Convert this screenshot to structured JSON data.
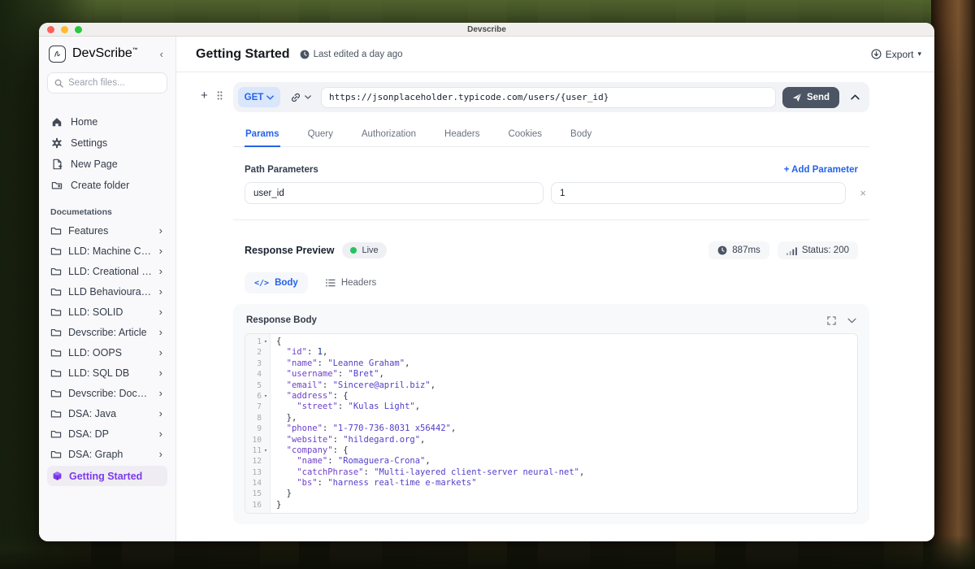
{
  "titlebar": {
    "title": "Devscribe"
  },
  "sidebar": {
    "brand": "DevScribe",
    "brand_tm": "™",
    "collapse_glyph": "‹",
    "search_placeholder": "Search files...",
    "nav": [
      {
        "label": "Home",
        "icon": "home-icon"
      },
      {
        "label": "Settings",
        "icon": "gear-icon"
      },
      {
        "label": "New Page",
        "icon": "new-page-icon"
      },
      {
        "label": "Create folder",
        "icon": "create-folder-icon"
      }
    ],
    "section_label": "Documetations",
    "chevron_glyph": "›",
    "docs": [
      "Features",
      "LLD: Machine Codir",
      "LLD: Creational DP",
      "LLD Behavioural DP",
      "LLD: SOLID",
      "Devscribe: Article",
      "LLD: OOPS",
      "LLD: SQL DB",
      "Devscribe: Docume",
      "DSA: Java",
      "DSA: DP",
      "DSA: Graph"
    ],
    "active": {
      "label": "Getting Started"
    }
  },
  "header": {
    "title": "Getting Started",
    "last_edited": "Last edited a day ago",
    "export_label": "Export",
    "export_caret": "▾"
  },
  "request": {
    "method": "GET",
    "url": "https://jsonplaceholder.typicode.com/users/{user_id}",
    "send_label": "Send",
    "tabs": [
      "Params",
      "Query",
      "Authorization",
      "Headers",
      "Cookies",
      "Body"
    ],
    "active_tab": "Params",
    "path_params": {
      "title": "Path Parameters",
      "add_label": "+ Add Parameter",
      "remove_glyph": "×",
      "rows": [
        {
          "key": "user_id",
          "value": "1"
        }
      ]
    }
  },
  "response": {
    "preview_label": "Response Preview",
    "live_label": "Live",
    "latency": "887ms",
    "status": "Status: 200",
    "tabs": [
      {
        "label": "Body"
      },
      {
        "label": "Headers"
      }
    ],
    "body_panel_title": "Response Body",
    "fold_glyph": "▾",
    "code": {
      "lines": [
        {
          "n": 1,
          "fold": true,
          "indent": 0,
          "tokens": [
            [
              "p",
              "{"
            ]
          ]
        },
        {
          "n": 2,
          "fold": false,
          "indent": 1,
          "tokens": [
            [
              "k",
              "\"id\""
            ],
            [
              "p",
              ": "
            ],
            [
              "n",
              "1"
            ],
            [
              "p",
              ","
            ]
          ]
        },
        {
          "n": 3,
          "fold": false,
          "indent": 1,
          "tokens": [
            [
              "k",
              "\"name\""
            ],
            [
              "p",
              ": "
            ],
            [
              "s",
              "\"Leanne Graham\""
            ],
            [
              "p",
              ","
            ]
          ]
        },
        {
          "n": 4,
          "fold": false,
          "indent": 1,
          "tokens": [
            [
              "k",
              "\"username\""
            ],
            [
              "p",
              ": "
            ],
            [
              "s",
              "\"Bret\""
            ],
            [
              "p",
              ","
            ]
          ]
        },
        {
          "n": 5,
          "fold": false,
          "indent": 1,
          "tokens": [
            [
              "k",
              "\"email\""
            ],
            [
              "p",
              ": "
            ],
            [
              "s",
              "\"Sincere@april.biz\""
            ],
            [
              "p",
              ","
            ]
          ]
        },
        {
          "n": 6,
          "fold": true,
          "indent": 1,
          "tokens": [
            [
              "k",
              "\"address\""
            ],
            [
              "p",
              ": {"
            ]
          ]
        },
        {
          "n": 7,
          "fold": false,
          "indent": 2,
          "tokens": [
            [
              "k",
              "\"street\""
            ],
            [
              "p",
              ": "
            ],
            [
              "s",
              "\"Kulas Light\""
            ],
            [
              "p",
              ","
            ]
          ]
        },
        {
          "n": 8,
          "fold": false,
          "indent": 1,
          "tokens": [
            [
              "p",
              "},"
            ]
          ]
        },
        {
          "n": 9,
          "fold": false,
          "indent": 1,
          "tokens": [
            [
              "k",
              "\"phone\""
            ],
            [
              "p",
              ": "
            ],
            [
              "s",
              "\"1-770-736-8031 x56442\""
            ],
            [
              "p",
              ","
            ]
          ]
        },
        {
          "n": 10,
          "fold": false,
          "indent": 1,
          "tokens": [
            [
              "k",
              "\"website\""
            ],
            [
              "p",
              ": "
            ],
            [
              "s",
              "\"hildegard.org\""
            ],
            [
              "p",
              ","
            ]
          ]
        },
        {
          "n": 11,
          "fold": true,
          "indent": 1,
          "tokens": [
            [
              "k",
              "\"company\""
            ],
            [
              "p",
              ": {"
            ]
          ]
        },
        {
          "n": 12,
          "fold": false,
          "indent": 2,
          "tokens": [
            [
              "k",
              "\"name\""
            ],
            [
              "p",
              ": "
            ],
            [
              "s",
              "\"Romaguera-Crona\""
            ],
            [
              "p",
              ","
            ]
          ]
        },
        {
          "n": 13,
          "fold": false,
          "indent": 2,
          "tokens": [
            [
              "k",
              "\"catchPhrase\""
            ],
            [
              "p",
              ": "
            ],
            [
              "s",
              "\"Multi-layered client-server neural-net\""
            ],
            [
              "p",
              ","
            ]
          ]
        },
        {
          "n": 14,
          "fold": false,
          "indent": 2,
          "tokens": [
            [
              "k",
              "\"bs\""
            ],
            [
              "p",
              ": "
            ],
            [
              "s",
              "\"harness real-time e-markets\""
            ]
          ]
        },
        {
          "n": 15,
          "fold": false,
          "indent": 1,
          "tokens": [
            [
              "p",
              "}"
            ]
          ]
        },
        {
          "n": 16,
          "fold": false,
          "indent": 0,
          "tokens": [
            [
              "p",
              "}"
            ]
          ]
        }
      ]
    }
  },
  "colors": {
    "accent_blue": "#2563eb",
    "brand_purple": "#7c3aed",
    "live_green": "#22c55e",
    "method_bg": "#d9e6fb",
    "send_bg": "#4b5563",
    "json_key": "#6e40c9",
    "json_string": "#5240c9",
    "json_number": "#16308f"
  }
}
